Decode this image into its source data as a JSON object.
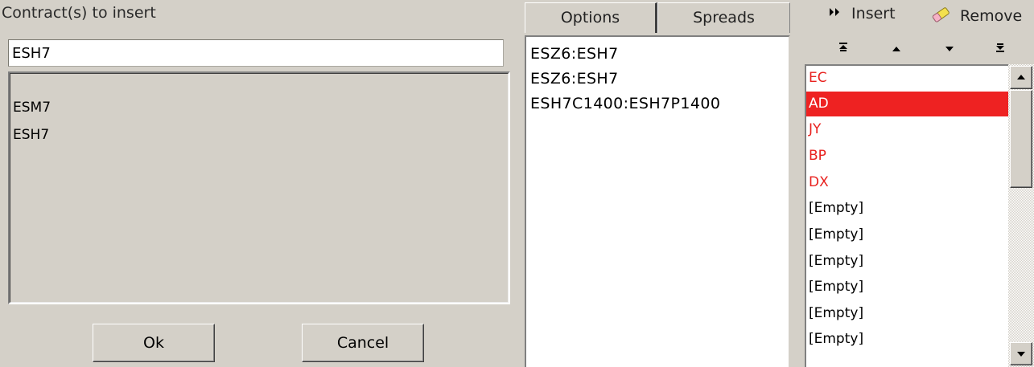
{
  "contract_panel": {
    "heading": "Contract(s) to insert",
    "input_value": "ESH7",
    "suggestions": [
      "ESM7",
      "ESH7"
    ],
    "ok_label": "Ok",
    "cancel_label": "Cancel"
  },
  "tabs": [
    {
      "label": "Options",
      "active": false
    },
    {
      "label": "Spreads",
      "active": true
    }
  ],
  "spreads": [
    "ESZ6:ESH7",
    "ESZ6:ESH7",
    "ESH7C1400:ESH7P1400"
  ],
  "toolbar": {
    "insert_label": "Insert",
    "insert_icon": "double-chevron-right-icon",
    "remove_label": "Remove",
    "remove_icon": "eraser-icon"
  },
  "move_buttons": [
    "move-to-top",
    "move-up",
    "move-down",
    "move-to-bottom"
  ],
  "markets": [
    {
      "label": "EC",
      "color": "red",
      "selected": false
    },
    {
      "label": "AD",
      "color": "white",
      "selected": true
    },
    {
      "label": "JY",
      "color": "red",
      "selected": false
    },
    {
      "label": "BP",
      "color": "red",
      "selected": false
    },
    {
      "label": "DX",
      "color": "red",
      "selected": false
    },
    {
      "label": "[Empty]",
      "color": "black",
      "selected": false
    },
    {
      "label": "[Empty]",
      "color": "black",
      "selected": false
    },
    {
      "label": "[Empty]",
      "color": "black",
      "selected": false
    },
    {
      "label": "[Empty]",
      "color": "black",
      "selected": false
    },
    {
      "label": "[Empty]",
      "color": "black",
      "selected": false
    },
    {
      "label": "[Empty]",
      "color": "black",
      "selected": false
    }
  ],
  "colors": {
    "background": "#d4d0c8",
    "accent_red": "#e8221f",
    "selection": "#ee2222"
  }
}
